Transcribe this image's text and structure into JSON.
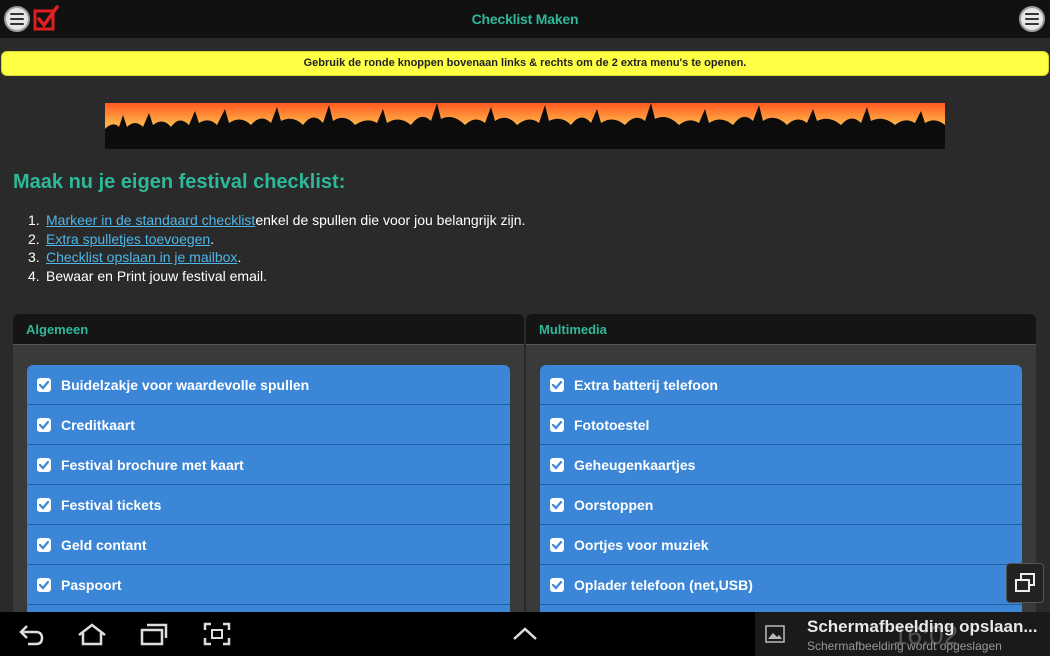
{
  "topbar": {
    "title": "Checklist Maken"
  },
  "notice": {
    "text": "Gebruik de ronde knoppen bovenaan links & rechts om de 2 extra menu's te openen."
  },
  "heading": "Maak nu je eigen festival checklist:",
  "steps": [
    {
      "num": "1.",
      "link": "Markeer in de standaard checklist",
      "rest": " enkel de spullen die voor jou belangrijk zijn."
    },
    {
      "num": "2.",
      "link": "Extra spulletjes toevoegen",
      "rest": "."
    },
    {
      "num": "3.",
      "link": "Checklist opslaan in je mailbox",
      "rest": "."
    },
    {
      "num": "4.",
      "link": "",
      "rest": "Bewaar en Print jouw festival email."
    }
  ],
  "panels": {
    "left": {
      "title": "Algemeen",
      "items": [
        "Buidelzakje voor waardevolle spullen",
        "Creditkaart",
        "Festival brochure met kaart",
        "Festival tickets",
        "Geld contant",
        "Paspoort"
      ]
    },
    "right": {
      "title": "Multimedia",
      "items": [
        "Extra batterij telefoon",
        "Fototoestel",
        "Geheugenkaartjes",
        "Oorstoppen",
        "Oortjes voor muziek",
        "Oplader telefoon (net,USB)"
      ]
    }
  },
  "status": {
    "notif_title": "Schermafbeelding opslaan...",
    "notif_sub": "Schermafbeelding wordt opgeslagen",
    "clock": "16:02"
  },
  "colors": {
    "accent": "#2eb89a",
    "list_item": "#3b86d6",
    "notice": "#ffff44",
    "link": "#4fb6e8"
  }
}
